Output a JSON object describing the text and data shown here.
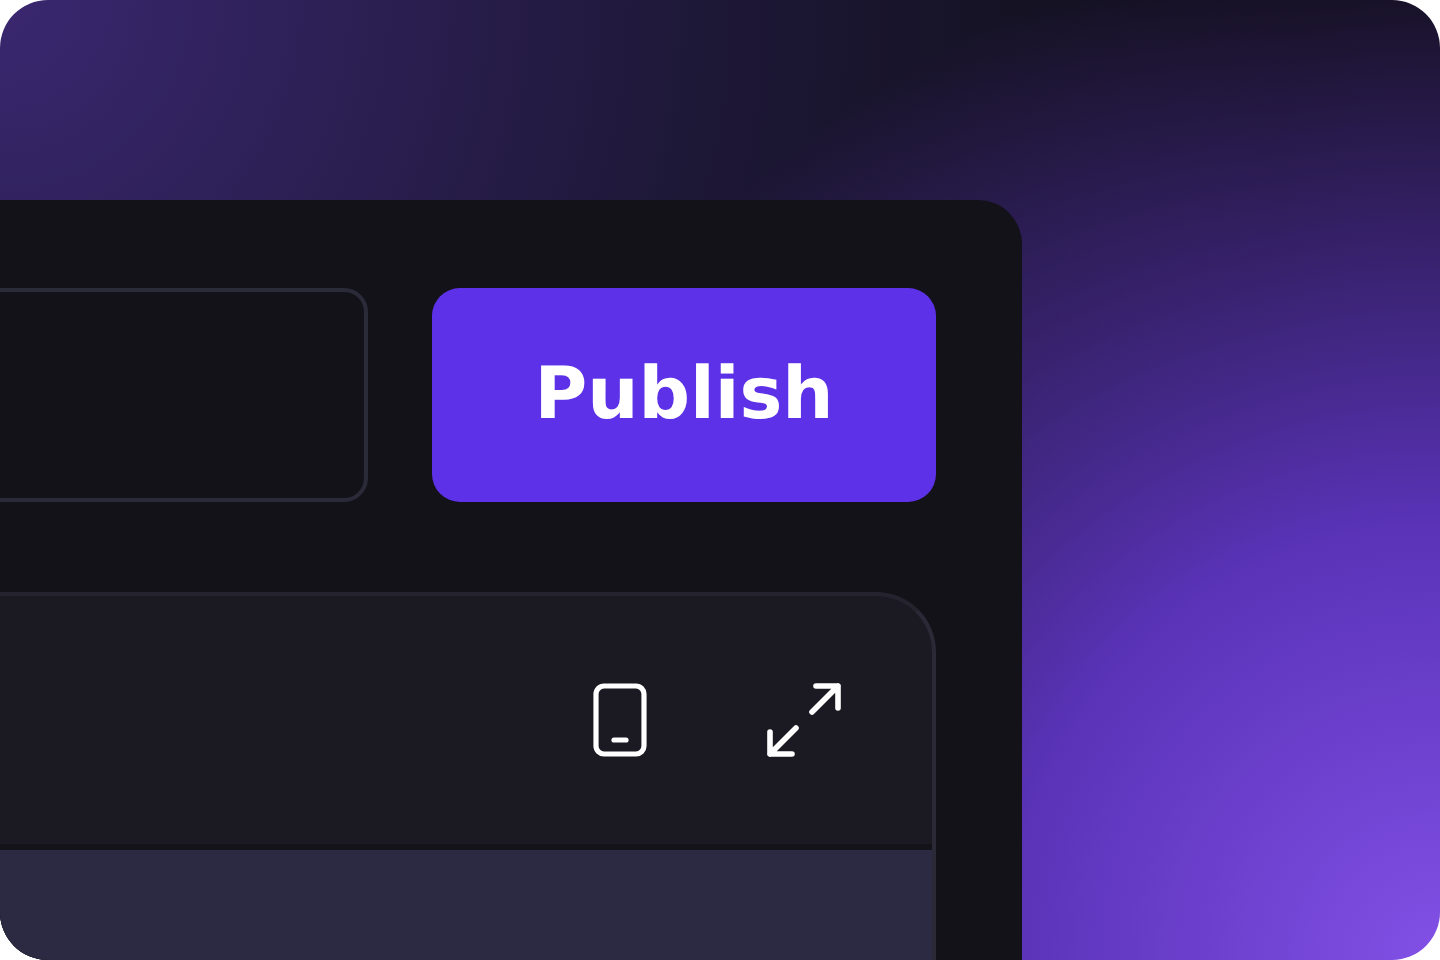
{
  "toolbar": {
    "primary_button": {
      "label": "Publish"
    }
  }
}
